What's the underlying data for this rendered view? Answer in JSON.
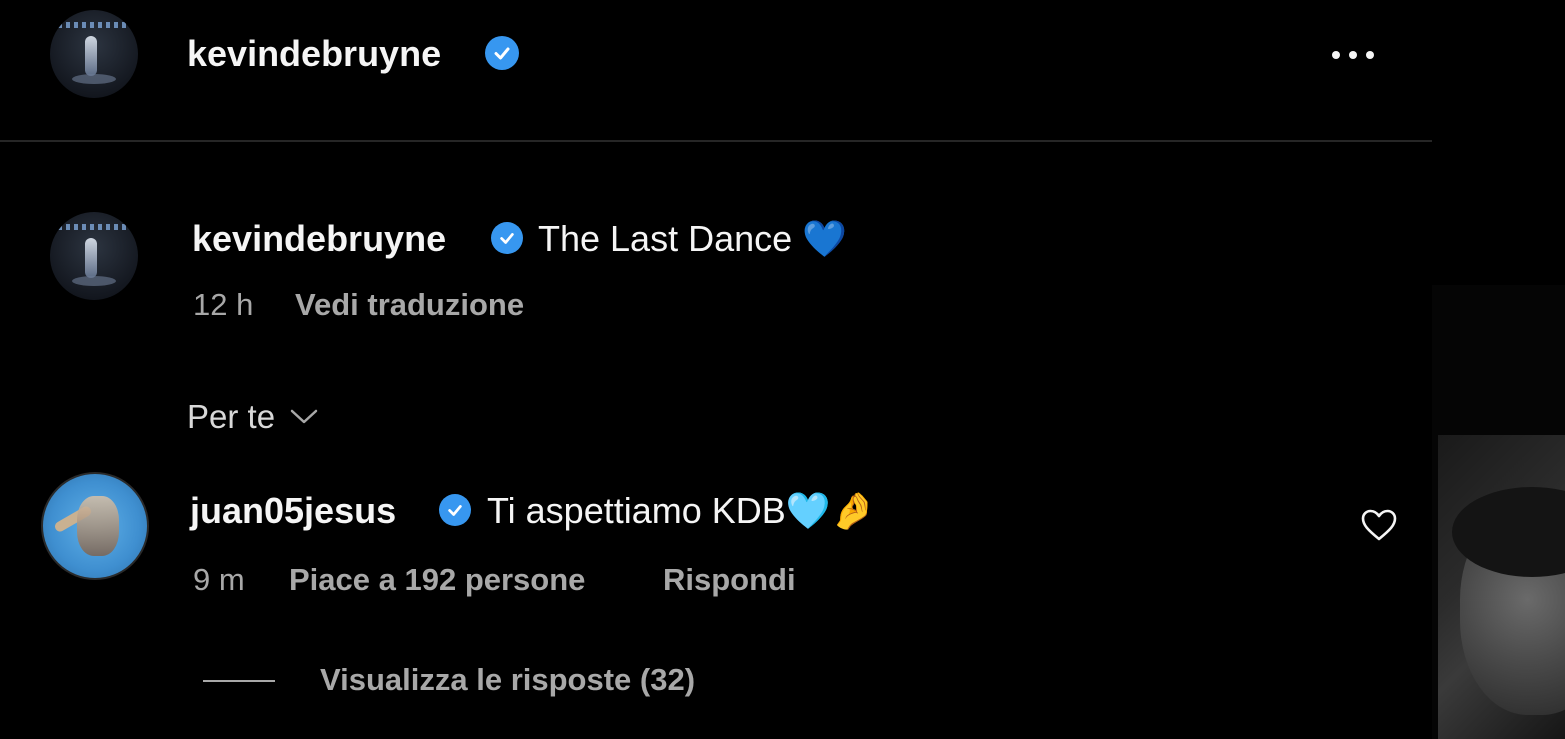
{
  "header": {
    "username": "kevindebruyne",
    "verified_icon": "verified-badge-icon",
    "more_icon": "more-options-icon"
  },
  "caption": {
    "username": "kevindebruyne",
    "text": "The Last Dance 💙",
    "time": "12 h",
    "translate": "Vedi traduzione"
  },
  "sort": {
    "label": "Per te",
    "icon": "chevron-down-icon"
  },
  "comment": {
    "username": "juan05jesus",
    "text": "Ti aspettiamo KDB🩵🤌",
    "time": "9 m",
    "likes": "Piace a 192 persone",
    "reply": "Rispondi",
    "like_icon": "heart-outline-icon"
  },
  "replies": {
    "label": "Visualizza le risposte (32)"
  },
  "colors": {
    "background": "#000000",
    "text": "#f5f5f5",
    "secondary_text": "#a8a8a8",
    "verified": "#3797f0",
    "divider": "#262626"
  }
}
